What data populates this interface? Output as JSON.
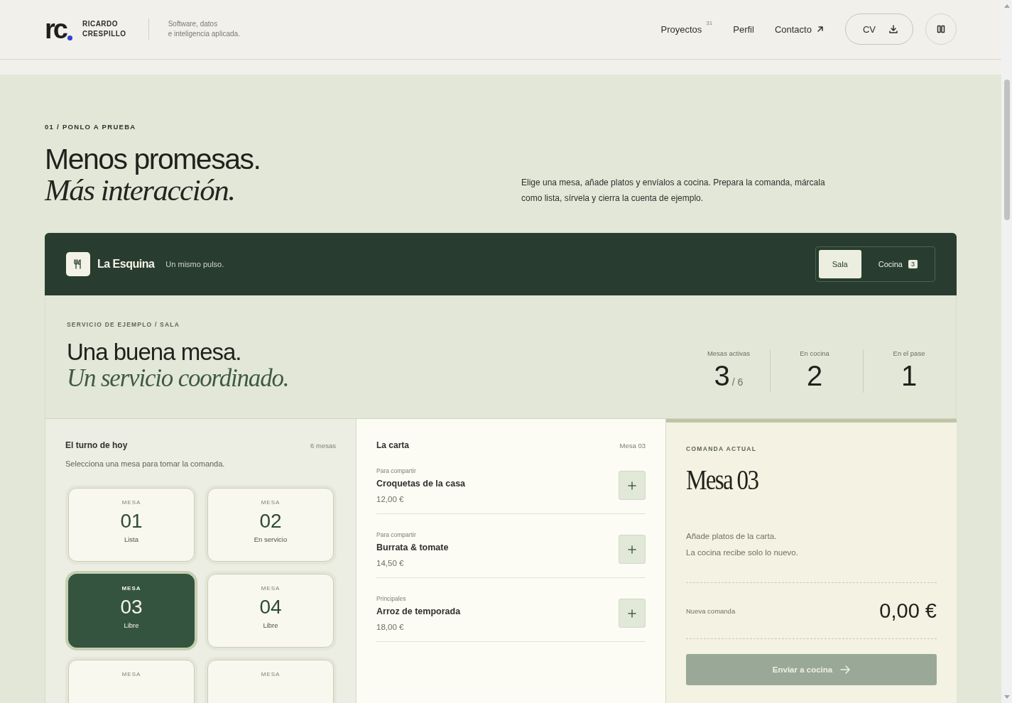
{
  "header": {
    "logo": "rc",
    "name_lines": [
      "RICARDO",
      "CRESPILLO"
    ],
    "tagline_lines": [
      "Software, datos",
      "e inteligencia aplicada."
    ],
    "nav": [
      {
        "label": "Proyectos",
        "count": "31",
        "kind": "count"
      },
      {
        "label": "Perfil",
        "kind": "plain"
      },
      {
        "label": "Contacto",
        "kind": "external"
      }
    ],
    "cv_button": "CV"
  },
  "section": {
    "eyebrow": "01 / PONLO A PRUEBA",
    "title": "Menos promesas.",
    "title_italic": "Más interacción.",
    "description": "Elige una mesa, añade platos y envíalos a cocina. Prepara la comanda, márcala como lista, sírvela y cierra la cuenta de ejemplo."
  },
  "demo": {
    "brand": "La Esquina",
    "slogan": "Un mismo pulso.",
    "views": [
      {
        "label": "Sala",
        "selected": true
      },
      {
        "label": "Cocina",
        "count": "3",
        "selected": false
      }
    ],
    "eyebrow": "SERVICIO DE EJEMPLO / SALA",
    "title": "Una buena mesa.",
    "title_italic": "Un servicio coordinado.",
    "stats": [
      {
        "label": "Mesas activas",
        "value": "3",
        "total": "/ 6"
      },
      {
        "label": "En cocina",
        "value": "2"
      },
      {
        "label": "En el pase",
        "value": "1"
      }
    ],
    "tables_panel": {
      "title": "El turno de hoy",
      "count": "6 mesas",
      "hint": "Selecciona una mesa para tomar la comanda.",
      "tables": [
        {
          "label": "MESA",
          "number": "01",
          "status": "Lista",
          "selected": false
        },
        {
          "label": "MESA",
          "number": "02",
          "status": "En servicio",
          "selected": false
        },
        {
          "label": "MESA",
          "number": "03",
          "status": "Libre",
          "selected": true
        },
        {
          "label": "MESA",
          "number": "04",
          "status": "Libre",
          "selected": false
        },
        {
          "label": "MESA",
          "selected": false
        },
        {
          "label": "MESA",
          "selected": false
        }
      ]
    },
    "menu_panel": {
      "title": "La carta",
      "table": "Mesa 03",
      "items": [
        {
          "category": "Para compartir",
          "name": "Croquetas de la casa",
          "price": "12,00 €"
        },
        {
          "category": "Para compartir",
          "name": "Burrata & tomate",
          "price": "14,50 €"
        },
        {
          "category": "Principales",
          "name": "Arroz de temporada",
          "price": "18,00 €"
        }
      ]
    },
    "order_panel": {
      "eyebrow": "COMANDA ACTUAL",
      "title": "Mesa 03",
      "empty_lines": [
        "Añade platos de la carta.",
        "La cocina recibe solo lo nuevo."
      ],
      "total_label": "Nueva comanda",
      "total": "0,00 €",
      "send_button": "Enviar a cocina",
      "send_disabled": true
    }
  }
}
